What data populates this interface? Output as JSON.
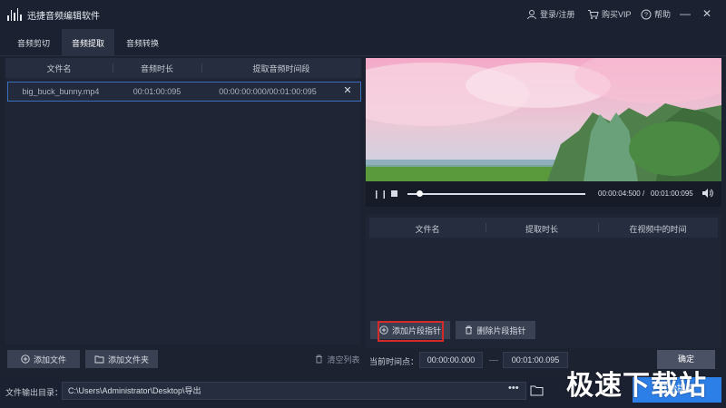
{
  "app": {
    "title": "迅捷音频编辑软件"
  },
  "titlebar": {
    "login": "登录/注册",
    "vip": "购买VIP",
    "help": "帮助",
    "minimize": "—",
    "close": "✕"
  },
  "tabs": [
    {
      "label": "音频剪切",
      "active": false
    },
    {
      "label": "音频提取",
      "active": true
    },
    {
      "label": "音频转换",
      "active": false
    }
  ],
  "file_list": {
    "headers": [
      "文件名",
      "音频时长",
      "提取音频时间段"
    ],
    "rows": [
      {
        "name": "big_buck_bunny.mp4",
        "duration": "00:01:00:095",
        "segment": "00:00:00:000/00:01:00:095"
      }
    ],
    "remove": "✕"
  },
  "left_buttons": {
    "add_file": "添加文件",
    "add_folder": "添加文件夹",
    "clear_list": "清空列表"
  },
  "player": {
    "pause": "❙❙",
    "current_time": "00:00:04:500",
    "separator": "/",
    "total_time": "00:01:00:095",
    "progress": 0.07
  },
  "segments": {
    "headers": [
      "文件名",
      "提取时长",
      "在视频中的时间"
    ],
    "add_pointer": "添加片段指针",
    "delete_pointer": "删除片段指针"
  },
  "time_point": {
    "label": "当前时间点：",
    "start": "00:00:00.000",
    "end": "00:01:00.095"
  },
  "confirm": "确定",
  "extract_button": "开始提取",
  "output": {
    "label": "文件输出目录：",
    "path": "C:\\Users\\Administrator\\Desktop\\导出",
    "browse": "•••"
  },
  "watermark": "极速下载站",
  "colors": {
    "accent": "#2d7fe8",
    "highlight": "#d42a2a",
    "selection": "#3a6fbf"
  }
}
